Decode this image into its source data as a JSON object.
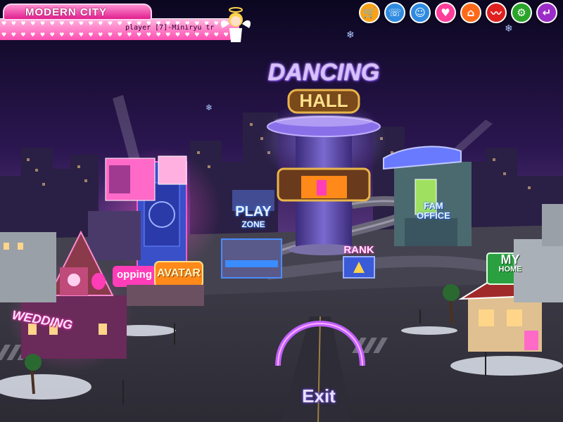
{
  "header": {
    "city_name": "MODERN CITY",
    "ticker_text": "player [7]-Miniryu tr"
  },
  "toolbar": {
    "buttons": [
      {
        "name": "shop",
        "icon": "shopping-cart-icon",
        "color": "#f7a21a"
      },
      {
        "name": "phone",
        "icon": "phone-icon",
        "color": "#2f8be0"
      },
      {
        "name": "friends",
        "icon": "people-icon",
        "color": "#2f8be0"
      },
      {
        "name": "favorites",
        "icon": "heart-icon",
        "color": "#ff3d9a"
      },
      {
        "name": "home",
        "icon": "house-icon",
        "color": "#ff6a1a"
      },
      {
        "name": "mail",
        "icon": "wave-icon",
        "color": "#e02020"
      },
      {
        "name": "settings",
        "icon": "gear-icon",
        "color": "#2aa52a"
      },
      {
        "name": "back",
        "icon": "return-arrow-icon",
        "color": "#9b2cc8"
      }
    ]
  },
  "buildings": {
    "dancing_hall_line1": "DANCING",
    "dancing_hall_line2": "HALL",
    "play_zone_line1": "PLAY",
    "play_zone_line2": "ZONE",
    "fam_office_line1": "FAM",
    "fam_office_line2": "OFFICE",
    "rank": "RANK",
    "my_home_line1": "MY",
    "my_home_line2": "HOME",
    "avatar": "AVATAR",
    "shopping": "opping",
    "wedding": "WEDDING"
  },
  "exit_label": "Exit",
  "colors": {
    "sky_top": "#0c0820",
    "sky_mid": "#4a2a72",
    "ground": "#3a3a44",
    "neon_pink": "#ff3db8",
    "neon_purple": "#b060ff",
    "neon_blue": "#3a8cff",
    "gold": "#e9b54a"
  }
}
